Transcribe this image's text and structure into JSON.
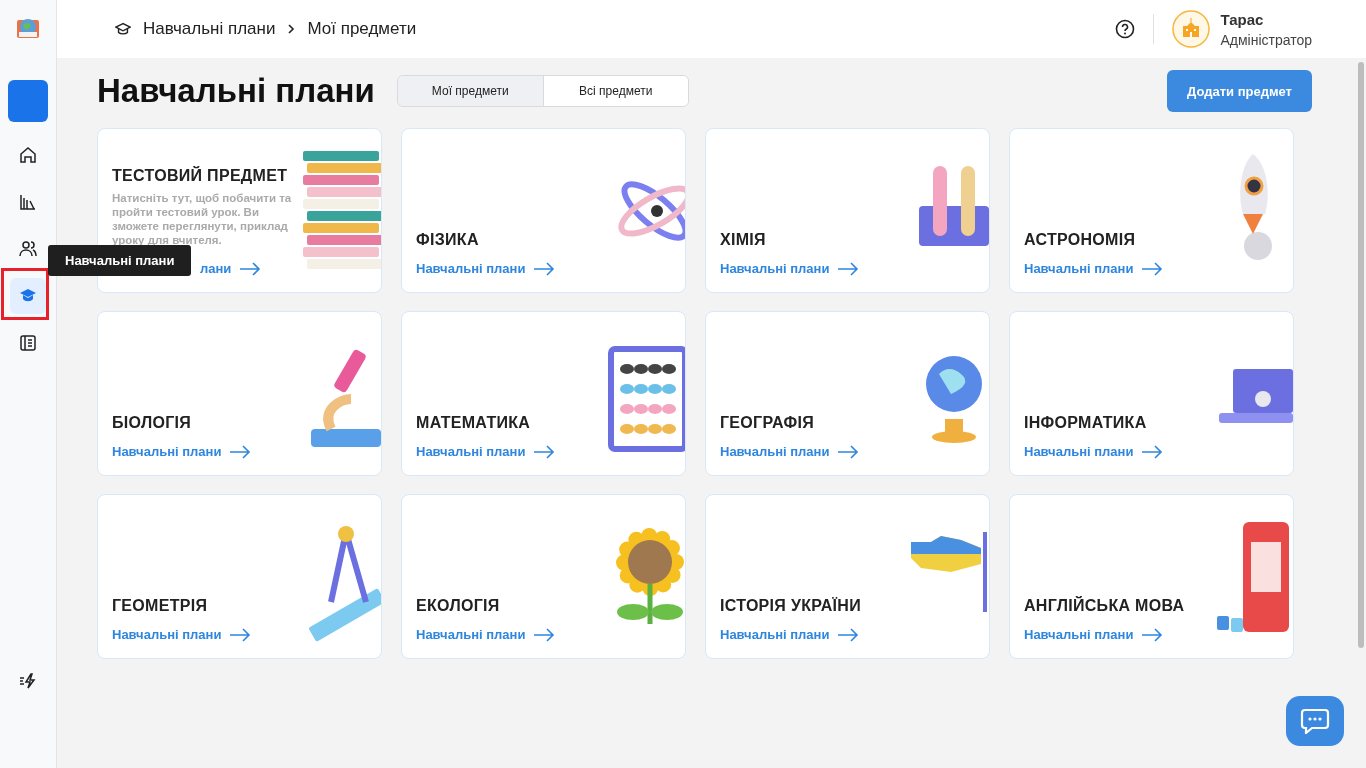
{
  "breadcrumb": {
    "items": [
      "Навчальні плани",
      "Мої предмети"
    ]
  },
  "user": {
    "name": "Тарас",
    "role": "Адміністратор"
  },
  "sidebar": {
    "items": [
      {
        "kind": "add",
        "selected": false
      },
      {
        "kind": "home",
        "selected": false
      },
      {
        "kind": "library",
        "selected": false
      },
      {
        "kind": "users",
        "selected": false
      },
      {
        "kind": "plans",
        "selected": true
      },
      {
        "kind": "notebook",
        "selected": false
      }
    ],
    "tooltip": "Навчальні плани"
  },
  "page": {
    "title": "Навчальні плани",
    "tabs": [
      {
        "label": "Мої предмети",
        "selected": true
      },
      {
        "label": "Всі предмети",
        "selected": false
      }
    ],
    "add_button": "Додати предмет"
  },
  "subjects": [
    {
      "kind": "intro",
      "title": "ТЕСТОВИЙ ПРЕДМЕТ",
      "description": "Натисніть тут, щоб побачити та пройти тестовий урок. Ви зможете переглянути, приклад уроку для вчителя.",
      "link": "лани"
    },
    {
      "kind": "subject",
      "title": "ФІЗИКА",
      "link": "Навчальні плани"
    },
    {
      "kind": "subject",
      "title": "ХІМІЯ",
      "link": "Навчальні плани"
    },
    {
      "kind": "subject",
      "title": "АСТРОНОМІЯ",
      "link": "Навчальні плани"
    },
    {
      "kind": "subject",
      "title": "БІОЛОГІЯ",
      "link": "Навчальні плани"
    },
    {
      "kind": "subject",
      "title": "МАТЕМАТИКА",
      "link": "Навчальні плани"
    },
    {
      "kind": "subject",
      "title": "ГЕОГРАФІЯ",
      "link": "Навчальні плани"
    },
    {
      "kind": "subject",
      "title": "ІНФОРМАТИКА",
      "link": "Навчальні плани"
    },
    {
      "kind": "subject",
      "title": "ГЕОМЕТРІЯ",
      "link": "Навчальні плани"
    },
    {
      "kind": "subject",
      "title": "ЕКОЛОГІЯ",
      "link": "Навчальні плани"
    },
    {
      "kind": "subject",
      "title": "ІСТОРІЯ УКРАЇНИ",
      "link": "Навчальні плани"
    },
    {
      "kind": "subject",
      "title": "АНГЛІЙСЬКА МОВА",
      "link": "Навчальні плани"
    }
  ]
}
